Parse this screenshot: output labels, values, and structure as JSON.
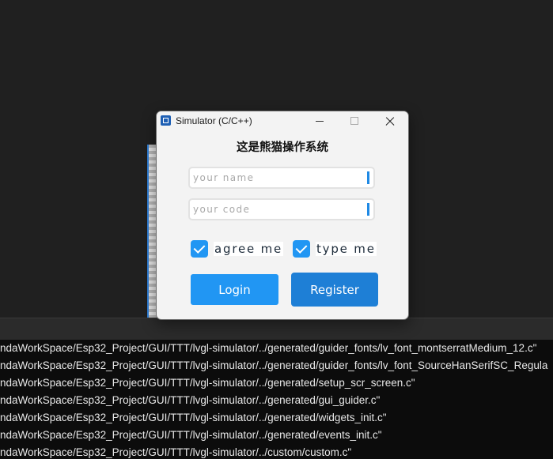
{
  "window": {
    "title": "Simulator (C/C++)"
  },
  "form": {
    "heading": "这是熊猫操作系统",
    "name_placeholder": "your name",
    "code_placeholder": "your code",
    "checkbox_agree": "agree me",
    "checkbox_type": "type me",
    "login_label": "Login",
    "register_label": "Register",
    "agree_checked": true,
    "type_checked": true
  },
  "console": {
    "lines": [
      "ndaWorkSpace/Esp32_Project/GUI/TTT/lvgl-simulator/../generated/guider_fonts/lv_font_montserratMedium_12.c\"",
      "ndaWorkSpace/Esp32_Project/GUI/TTT/lvgl-simulator/../generated/guider_fonts/lv_font_SourceHanSerifSC_Regula",
      "ndaWorkSpace/Esp32_Project/GUI/TTT/lvgl-simulator/../generated/setup_scr_screen.c\"",
      "ndaWorkSpace/Esp32_Project/GUI/TTT/lvgl-simulator/../generated/gui_guider.c\"",
      "ndaWorkSpace/Esp32_Project/GUI/TTT/lvgl-simulator/../generated/widgets_init.c\"",
      "ndaWorkSpace/Esp32_Project/GUI/TTT/lvgl-simulator/../generated/events_init.c\"",
      "ndaWorkSpace/Esp32_Project/GUI/TTT/lvgl-simulator/../custom/custom.c\""
    ]
  },
  "colors": {
    "accent": "#2196f3",
    "register": "#1e7fd6",
    "background": "#202020",
    "console_bg": "#0c0c0c"
  }
}
